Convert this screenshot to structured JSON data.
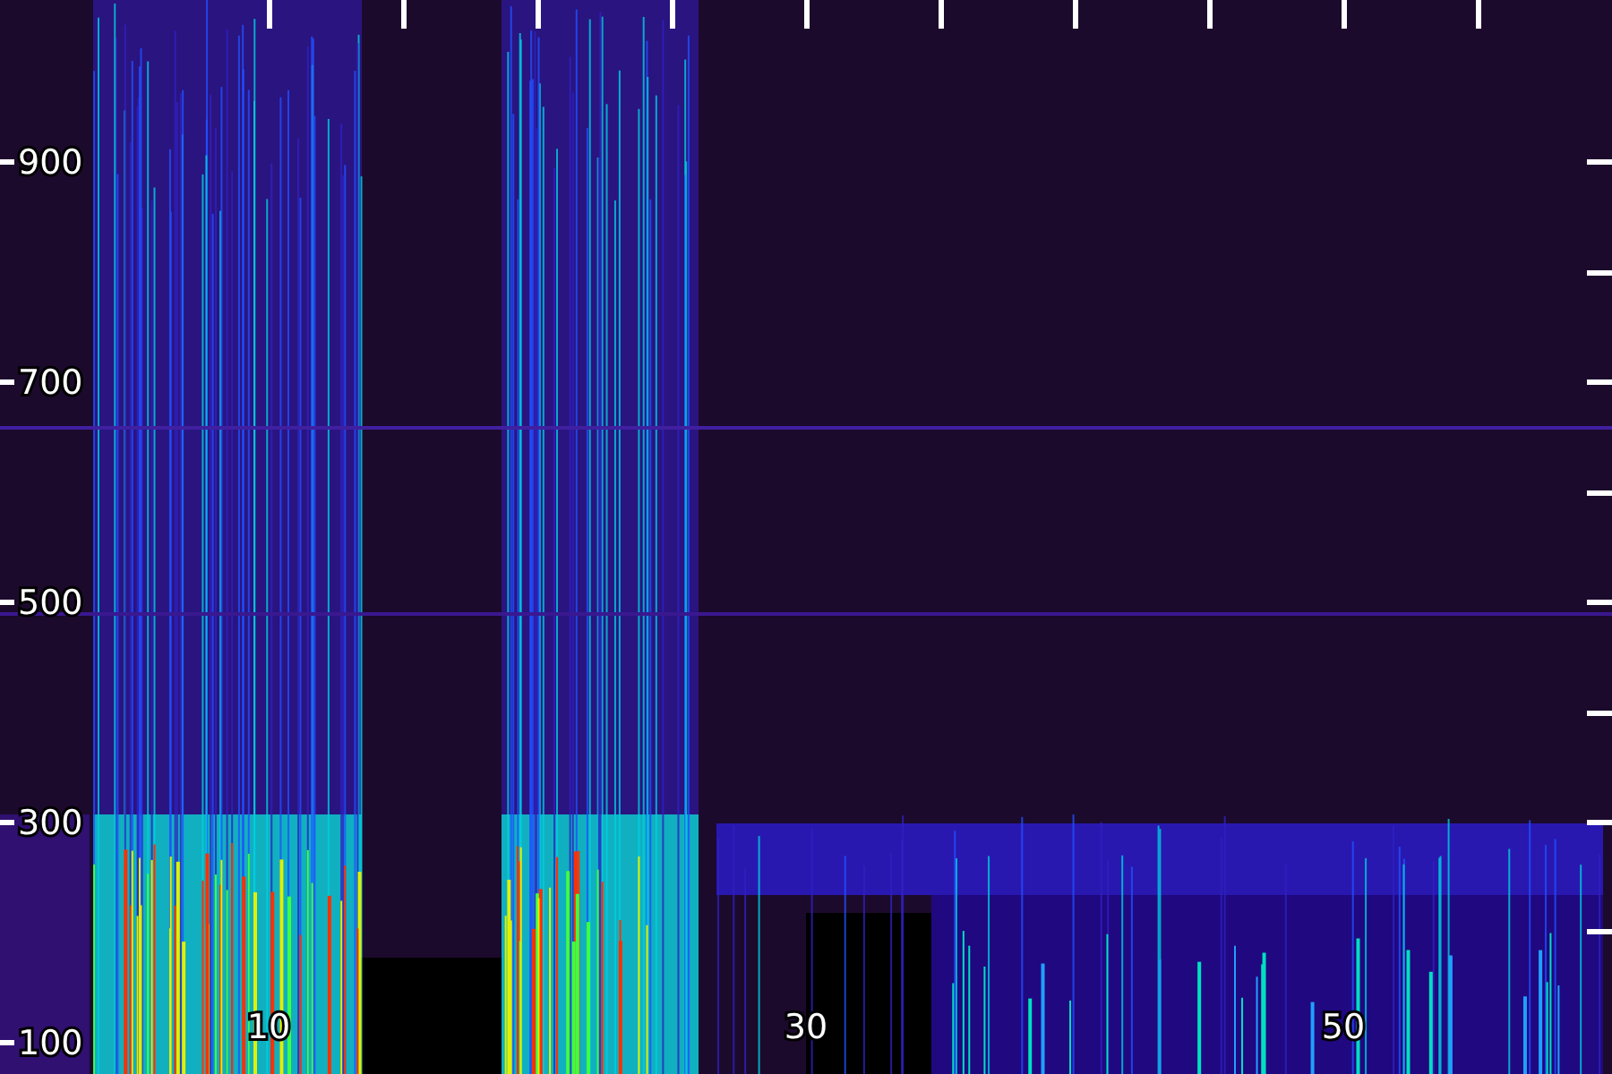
{
  "y_axis": {
    "labels": [
      "900",
      "700",
      "500",
      "300",
      "100"
    ]
  },
  "x_axis": {
    "labels": [
      "10",
      "30",
      "50"
    ]
  }
}
